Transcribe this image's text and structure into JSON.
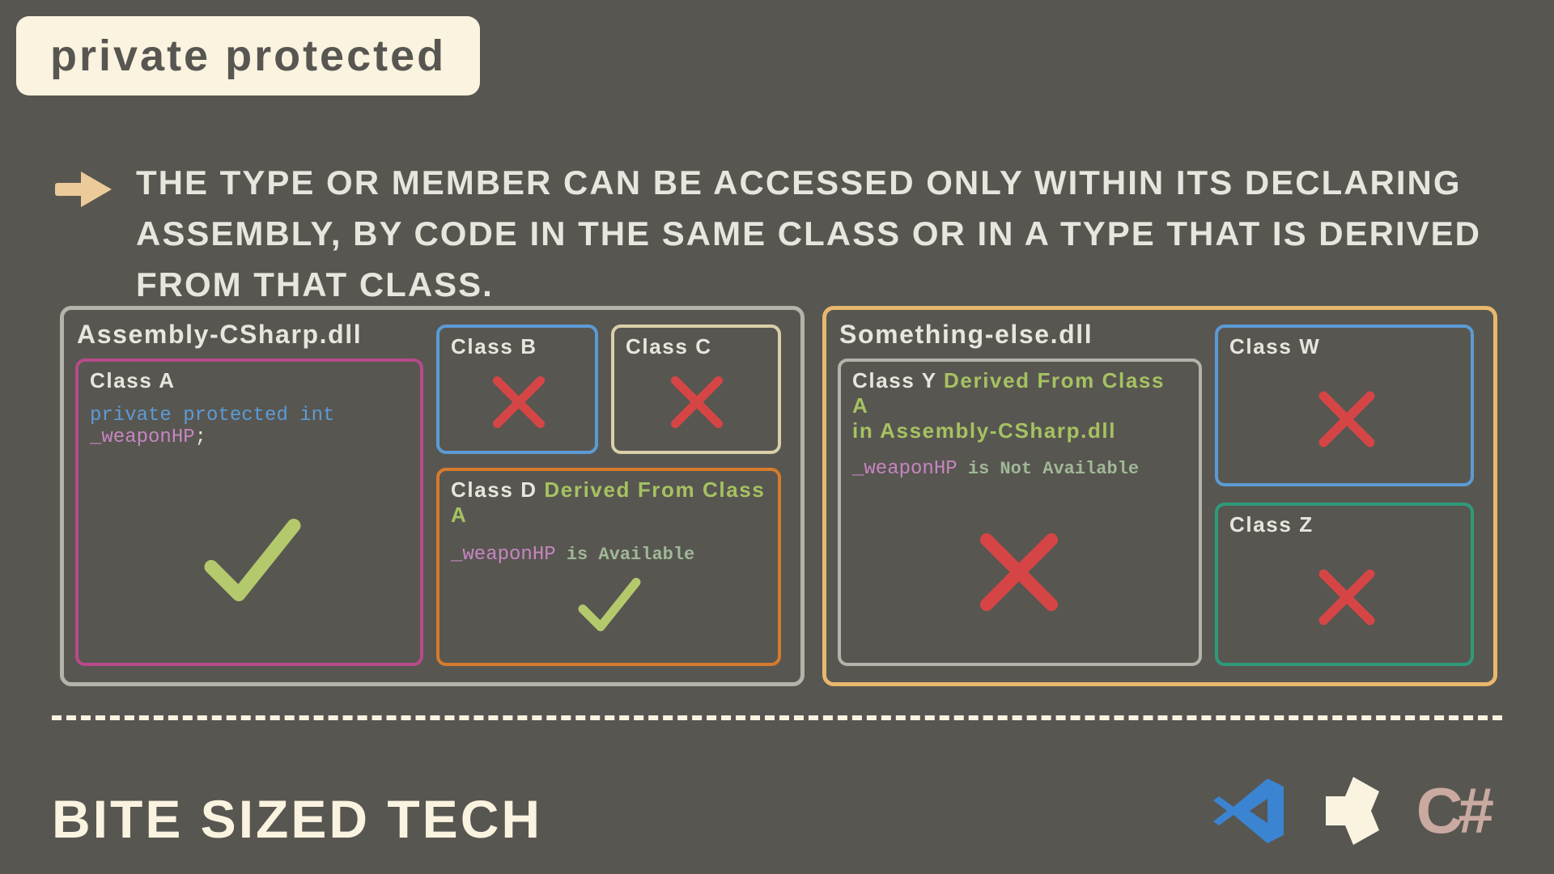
{
  "title": "private protected",
  "description": "The type or member can be accessed only within its declaring assembly, by code in the same class or in a type that is derived from that class.",
  "assembly1": {
    "name": "Assembly-CSharp.dll",
    "classA": {
      "name": "Class A",
      "keyword": "private protected",
      "type": "int",
      "field": "_weaponHP",
      "punct": ";"
    },
    "classB": {
      "name": "Class B"
    },
    "classC": {
      "name": "Class C"
    },
    "classD": {
      "name": "Class D",
      "derived": "Derived From Class A",
      "field": "_weaponHP",
      "avail": " is Available"
    }
  },
  "assembly2": {
    "name": "Something-else.dll",
    "classY": {
      "name": "Class Y",
      "derived1": "Derived From Class A",
      "derived2": "in Assembly-CSharp.dll",
      "field": "_weaponHP",
      "avail": " is Not Available"
    },
    "classW": {
      "name": "Class W"
    },
    "classZ": {
      "name": "Class Z"
    }
  },
  "footer": "bite sized tech",
  "csharp": "C#",
  "colors": {
    "assembly1_border": "#b5b2a9",
    "assembly2_border": "#e8b86d",
    "classA_border": "#b84a8a",
    "classB_border": "#5b9bd5",
    "classC_border": "#d9cfa8",
    "classD_border": "#d67b2d",
    "classY_border": "#b5b2a9",
    "classW_border": "#5b9bd5",
    "classZ_border": "#2d9b7a"
  }
}
